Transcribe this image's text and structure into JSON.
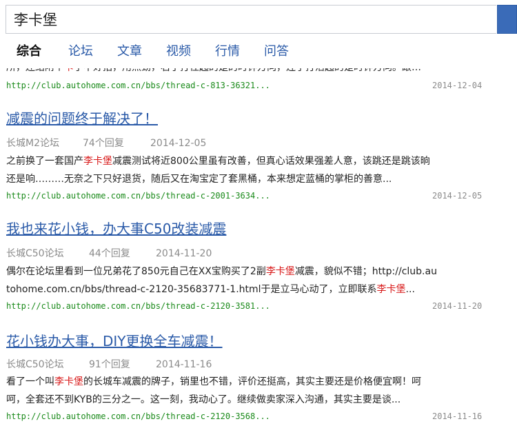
{
  "search": {
    "value": "李卡堡"
  },
  "tabs": [
    {
      "label": "综合",
      "active": true
    },
    {
      "label": "论坛"
    },
    {
      "label": "文章"
    },
    {
      "label": "视频"
    },
    {
      "label": "行情"
    },
    {
      "label": "问答"
    }
  ],
  "results": [
    {
      "cut_snippet": [
        {
          "t": "所，还结附个"
        },
        {
          "t": "卡",
          "hl": true
        },
        {
          "t": "了不好拍，用点劲，右了打往起的是的时钟方向，连了打活起的是时钟方向。跟…"
        }
      ],
      "url": "http://club.autohome.com.cn/bbs/thread-c-813-36321...",
      "date": "2014-12-04"
    },
    {
      "title": "减震的问题终于解决了！",
      "forum": "长城M2论坛",
      "replies": "74个回复",
      "post_date": "2014-12-05",
      "snippet_lines": [
        [
          {
            "t": "之前换了一套国产"
          },
          {
            "t": "李卡堡",
            "hl": true
          },
          {
            "t": "减震测试将近800公里虽有改善，但真心话效果强差人意，该跳还是跳该晌"
          }
        ],
        [
          {
            "t": "还是响………无奈之下只好退货，随后又在淘宝定了套黑桶，本来想定蓝桶的掌柜的善意..."
          }
        ]
      ],
      "url": "http://club.autohome.com.cn/bbs/thread-c-2001-3634...",
      "date": "2014-12-05"
    },
    {
      "title": "我也来花小钱，办大事C50改装减震",
      "forum": "长城C50论坛",
      "replies": "44个回复",
      "post_date": "2014-11-20",
      "snippet_lines": [
        [
          {
            "t": "偶尔在论坛里看到一位兄弟花了850元自己在XX宝购买了2副"
          },
          {
            "t": "李卡堡",
            "hl": true
          },
          {
            "t": "减震，貌似不错；http://club.au"
          }
        ],
        [
          {
            "t": "tohome.com.cn/bbs/thread-c-2120-35683771-1.html于是立马心动了，立即联系"
          },
          {
            "t": "李卡堡",
            "hl": true
          },
          {
            "t": "..."
          }
        ]
      ],
      "url": "http://club.autohome.com.cn/bbs/thread-c-2120-3581...",
      "date": "2014-11-20"
    },
    {
      "title": "花小钱办大事，DIY更换全车减震！",
      "forum": "长城C50论坛",
      "replies": "91个回复",
      "post_date": "2014-11-16",
      "snippet_lines": [
        [
          {
            "t": "看了一个叫"
          },
          {
            "t": "李卡堡",
            "hl": true
          },
          {
            "t": "的长城车减震的牌子，销里也不错，评价还挺高，其实主要还是价格便宜啊！呵"
          }
        ],
        [
          {
            "t": "呵，全套还不到KYB的三分之一。这一刻，我动心了。继续做卖家深入沟通，其实主要是谈..."
          }
        ]
      ],
      "url": "http://club.autohome.com.cn/bbs/thread-c-2120-3568...",
      "date": "2014-11-16"
    }
  ]
}
